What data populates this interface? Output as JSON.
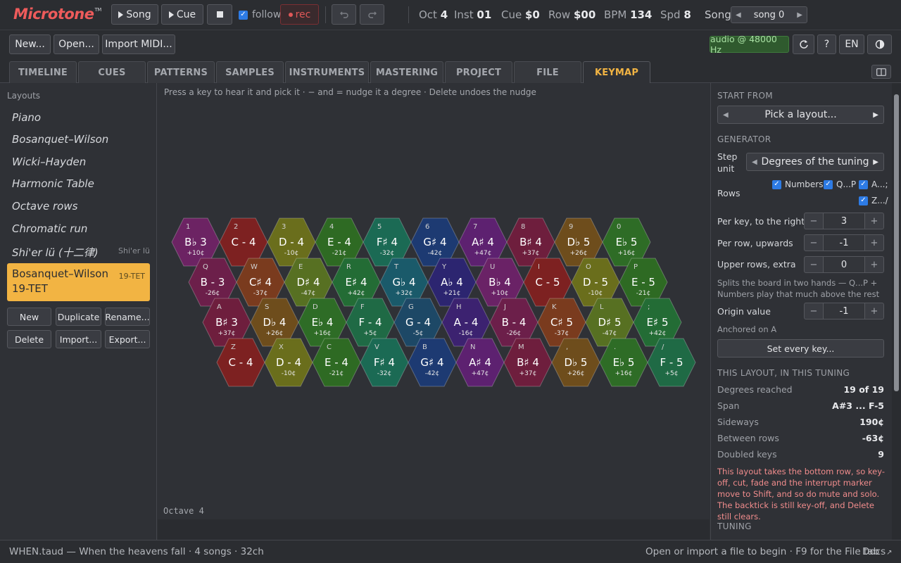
{
  "app": {
    "name": "Microtone",
    "tm": "TM"
  },
  "transport": {
    "song_label": "Song",
    "cue_label": "Cue",
    "follow_label": "follow",
    "rec_label": "rec"
  },
  "status_stats": [
    {
      "label": "Oct",
      "value": "4"
    },
    {
      "label": "Inst",
      "value": "01"
    },
    {
      "label": "Cue",
      "value": "$0"
    },
    {
      "label": "Row",
      "value": "$00"
    },
    {
      "label": "BPM",
      "value": "134"
    },
    {
      "label": "Spd",
      "value": "8"
    }
  ],
  "song_selector": {
    "label": "Song",
    "value": "song 0"
  },
  "toolbar": {
    "new": "New...",
    "open": "Open...",
    "import_midi": "Import MIDI...",
    "audio": "audio @ 48000 Hz",
    "help": "?",
    "lang": "EN"
  },
  "tabs": [
    "TIMELINE",
    "CUES",
    "PATTERNS",
    "SAMPLES",
    "INSTRUMENTS",
    "MASTERING",
    "PROJECT",
    "FILE",
    "KEYMAP"
  ],
  "active_tab": "KEYMAP",
  "layouts": {
    "heading": "Layouts",
    "items": [
      "Piano",
      "Bosanquet–Wilson",
      "Wicki–Hayden",
      "Harmonic Table",
      "Octave rows",
      "Chromatic run",
      "Shi'er lü (十二律)"
    ],
    "shier_sub": "Shi'er lü",
    "selected": {
      "name": "Bosanquet–Wilson 19-TET",
      "tag": "19-TET"
    },
    "buttons": {
      "new": "New",
      "duplicate": "Duplicate",
      "rename": "Rename...",
      "delete": "Delete",
      "import": "Import...",
      "export": "Export..."
    }
  },
  "keymap": {
    "hint": "Press a key to hear it and pick it · − and = nudge it a degree · Delete undoes the nudge",
    "octave": "Octave 4",
    "rows": [
      [
        {
          "key": "1",
          "note": "B♭ 3",
          "cents": "+10¢",
          "color": "#6c2363"
        },
        {
          "key": "2",
          "note": "C - 4",
          "cents": "",
          "color": "#7d2121"
        },
        {
          "key": "3",
          "note": "D - 4",
          "cents": "-10¢",
          "color": "#6a6e1c"
        },
        {
          "key": "4",
          "note": "E - 4",
          "cents": "-21¢",
          "color": "#2e6a23"
        },
        {
          "key": "5",
          "note": "F♯ 4",
          "cents": "-32¢",
          "color": "#1b6a54"
        },
        {
          "key": "6",
          "note": "G♯ 4",
          "cents": "-42¢",
          "color": "#1d3a72"
        },
        {
          "key": "7",
          "note": "A♯ 4",
          "cents": "+47¢",
          "color": "#5d2170"
        },
        {
          "key": "8",
          "note": "B♯ 4",
          "cents": "+37¢",
          "color": "#6e1e3d"
        },
        {
          "key": "9",
          "note": "D♭ 5",
          "cents": "+26¢",
          "color": "#6e4d1c"
        },
        {
          "key": "0",
          "note": "E♭ 5",
          "cents": "+16¢",
          "color": "#2e6c26"
        }
      ],
      [
        {
          "key": "Q",
          "note": "B - 3",
          "cents": "-26¢",
          "color": "#6c1f4a"
        },
        {
          "key": "W",
          "note": "C♯ 4",
          "cents": "-37¢",
          "color": "#7a3b1e"
        },
        {
          "key": "E",
          "note": "D♯ 4",
          "cents": "-47¢",
          "color": "#577022"
        },
        {
          "key": "R",
          "note": "E♯ 4",
          "cents": "+42¢",
          "color": "#236c35"
        },
        {
          "key": "T",
          "note": "G♭ 4",
          "cents": "+32¢",
          "color": "#1a5a6a"
        },
        {
          "key": "Y",
          "note": "A♭ 4",
          "cents": "+21¢",
          "color": "#2c2570"
        },
        {
          "key": "U",
          "note": "B♭ 4",
          "cents": "+10¢",
          "color": "#6a2266"
        },
        {
          "key": "I",
          "note": "C - 5",
          "cents": "",
          "color": "#7d2121"
        },
        {
          "key": "O",
          "note": "D - 5",
          "cents": "-10¢",
          "color": "#6a6e1c"
        },
        {
          "key": "P",
          "note": "E - 5",
          "cents": "-21¢",
          "color": "#2e6a23"
        }
      ],
      [
        {
          "key": "A",
          "note": "B♯ 3",
          "cents": "+37¢",
          "color": "#6e1e3d"
        },
        {
          "key": "S",
          "note": "D♭ 4",
          "cents": "+26¢",
          "color": "#6e4d1c"
        },
        {
          "key": "D",
          "note": "E♭ 4",
          "cents": "+16¢",
          "color": "#2e6c26"
        },
        {
          "key": "F",
          "note": "F - 4",
          "cents": "+5¢",
          "color": "#1f6a45"
        },
        {
          "key": "G",
          "note": "G - 4",
          "cents": "-5¢",
          "color": "#1d4866"
        },
        {
          "key": "H",
          "note": "A - 4",
          "cents": "-16¢",
          "color": "#3c2270"
        },
        {
          "key": "J",
          "note": "B - 4",
          "cents": "-26¢",
          "color": "#6c1f4a"
        },
        {
          "key": "K",
          "note": "C♯ 5",
          "cents": "-37¢",
          "color": "#7a3b1e"
        },
        {
          "key": "L",
          "note": "D♯ 5",
          "cents": "-47¢",
          "color": "#577022"
        },
        {
          "key": ";",
          "note": "E♯ 5",
          "cents": "+42¢",
          "color": "#236c35"
        }
      ],
      [
        {
          "key": "Z",
          "note": "C - 4",
          "cents": "",
          "color": "#7d2121"
        },
        {
          "key": "X",
          "note": "D - 4",
          "cents": "-10¢",
          "color": "#6a6e1c"
        },
        {
          "key": "C",
          "note": "E - 4",
          "cents": "-21¢",
          "color": "#2e6a23"
        },
        {
          "key": "V",
          "note": "F♯ 4",
          "cents": "-32¢",
          "color": "#1b6a54"
        },
        {
          "key": "B",
          "note": "G♯ 4",
          "cents": "-42¢",
          "color": "#1d3a72"
        },
        {
          "key": "N",
          "note": "A♯ 4",
          "cents": "+47¢",
          "color": "#5d2170"
        },
        {
          "key": "M",
          "note": "B♯ 4",
          "cents": "+37¢",
          "color": "#6e1e3d"
        },
        {
          "key": ",",
          "note": "D♭ 5",
          "cents": "+26¢",
          "color": "#6e4d1c"
        },
        {
          "key": ".",
          "note": "E♭ 5",
          "cents": "+16¢",
          "color": "#2e6c26"
        },
        {
          "key": "/",
          "note": "F - 5",
          "cents": "+5¢",
          "color": "#1f6a45"
        }
      ]
    ]
  },
  "right": {
    "start_from": "START FROM",
    "pick_layout": "Pick a layout...",
    "generator": "GENERATOR",
    "step_unit_label": "Step unit",
    "step_unit_value": "Degrees of the tuning",
    "rows_label": "Rows",
    "row_checks": [
      "Numbers",
      "Q...P",
      "A...;",
      "Z.../"
    ],
    "per_key_label": "Per key, to the right",
    "per_key_value": "3",
    "per_row_label": "Per row, upwards",
    "per_row_value": "-1",
    "upper_label": "Upper rows, extra",
    "upper_value": "0",
    "upper_note": "Splits the board in two hands — Q...P + Numbers play that much above the rest",
    "origin_label": "Origin value",
    "origin_value": "-1",
    "anchored": "Anchored on A",
    "set_every": "Set every key...",
    "this_layout": "THIS LAYOUT, IN THIS TUNING",
    "stats": [
      {
        "label": "Degrees reached",
        "value": "19 of 19"
      },
      {
        "label": "Span",
        "value": "A#3 ... F-5"
      },
      {
        "label": "Sideways",
        "value": "190¢"
      },
      {
        "label": "Between rows",
        "value": "-63¢"
      },
      {
        "label": "Doubled keys",
        "value": "9"
      }
    ],
    "warning": "This layout takes the bottom row, so key-off, cut, fade and the interrupt marker move to Shift, and so do mute and solo. The backtick is still key-off, and Delete still clears.",
    "tuning": "TUNING"
  },
  "statusbar": {
    "left": "WHEN.taud — When the heavens fall · 4 songs · 32ch",
    "right": "Open or import a file to begin · F9 for the File tab",
    "docs": "Docs"
  }
}
